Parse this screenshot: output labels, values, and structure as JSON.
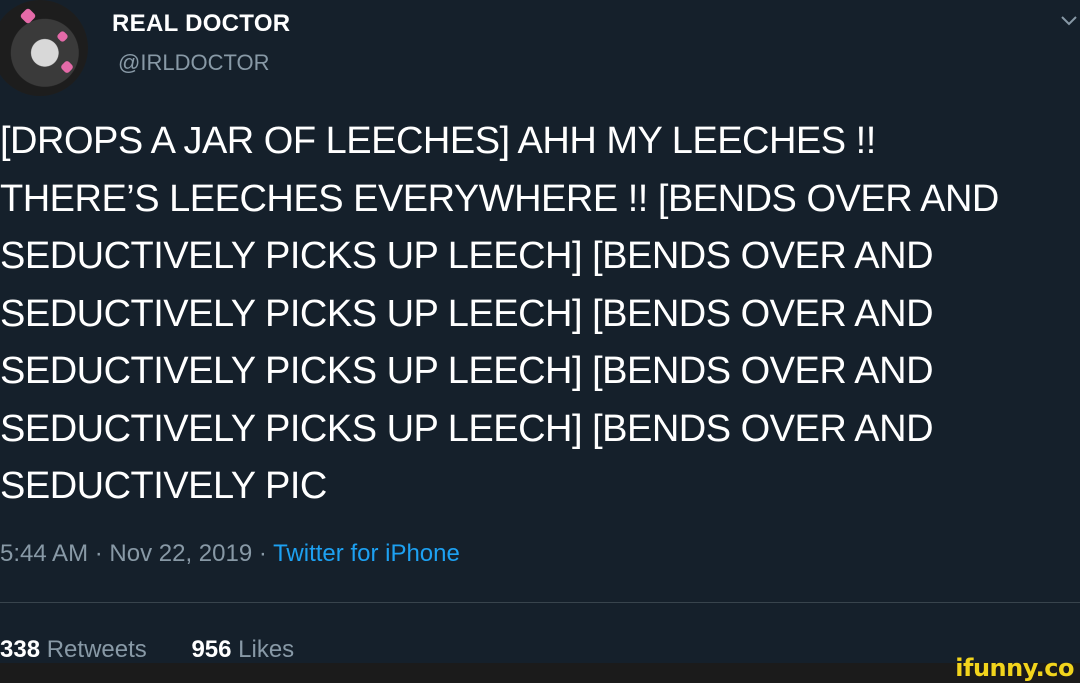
{
  "user": {
    "display_name": "REAL DOCTOR",
    "handle": "@IRLDOCTOR",
    "avatar_icon": "avatar-image"
  },
  "tweet": {
    "text": "[DROPS A JAR OF LEECHES] AHH MY LEECHES !!\nTHERE’S LEECHES EVERYWHERE !! [BENDS OVER AND\nSEDUCTIVELY PICKS UP LEECH] [BENDS OVER AND\nSEDUCTIVELY PICKS UP LEECH] [BENDS OVER AND\nSEDUCTIVELY PICKS UP LEECH] [BENDS OVER AND\nSEDUCTIVELY PICKS UP LEECH] [BENDS OVER AND\nSEDUCTIVELY PIC",
    "time": "5:44 AM",
    "date": "Nov 22, 2019",
    "separator": "·",
    "source": "Twitter for iPhone"
  },
  "stats": {
    "retweets_count": "338",
    "retweets_label": "Retweets",
    "likes_count": "956",
    "likes_label": "Likes"
  },
  "watermark": "ifunny.co",
  "colors": {
    "background": "#15202b",
    "secondary_text": "#8899a6",
    "link": "#1da1f2",
    "divider": "#38444d",
    "watermark": "#f2d41c"
  }
}
